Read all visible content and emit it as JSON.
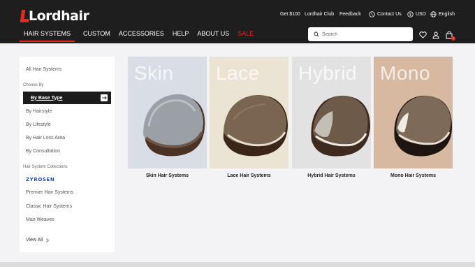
{
  "brand": {
    "name": "Lordhair"
  },
  "utility": {
    "get100": "Get $100",
    "club": "Lordhair Club",
    "feedback": "Feedback",
    "contact": "Contact Us",
    "currency": "USD",
    "language": "English"
  },
  "nav": {
    "items": [
      "HAIR SYSTEMS",
      "CUSTOM",
      "ACCESSORIES",
      "HELP",
      "ABOUT US",
      "SALE"
    ],
    "active": "HAIR SYSTEMS"
  },
  "search": {
    "placeholder": "Search"
  },
  "cart": {
    "count": "1"
  },
  "sidebar": {
    "all": "All Hair Systems",
    "choose_by": "Choose By",
    "by_base_type": "By Base Type",
    "by_hairstyle": "By Hairstyle",
    "by_lifestyle": "By Lifestyle",
    "by_hair_loss": "By Hair Loss Area",
    "by_consultation": "By Consultation",
    "collections_head": "Hair System Collections",
    "zyrosen": "ZYROSEN",
    "premier": "Premier Hair Systems",
    "classic": "Classic Hair Systems",
    "man_weaves": "Man Weaves",
    "view_all": "View All"
  },
  "cards": [
    {
      "word": "Skin",
      "caption": "Skin Hair Systems",
      "bg": "#d9dde6"
    },
    {
      "word": "Lace",
      "caption": "Lace Hair Systems",
      "bg": "#ebe3d4"
    },
    {
      "word": "Hybrid",
      "caption": "Hybrid Hair Systems",
      "bg": "#e2e2e3"
    },
    {
      "word": "Mono",
      "caption": "Mono Hair Systems",
      "bg": "#d6b9a0"
    }
  ],
  "colors": {
    "accent": "#e8291f",
    "header_bg": "#1e1e1e"
  }
}
